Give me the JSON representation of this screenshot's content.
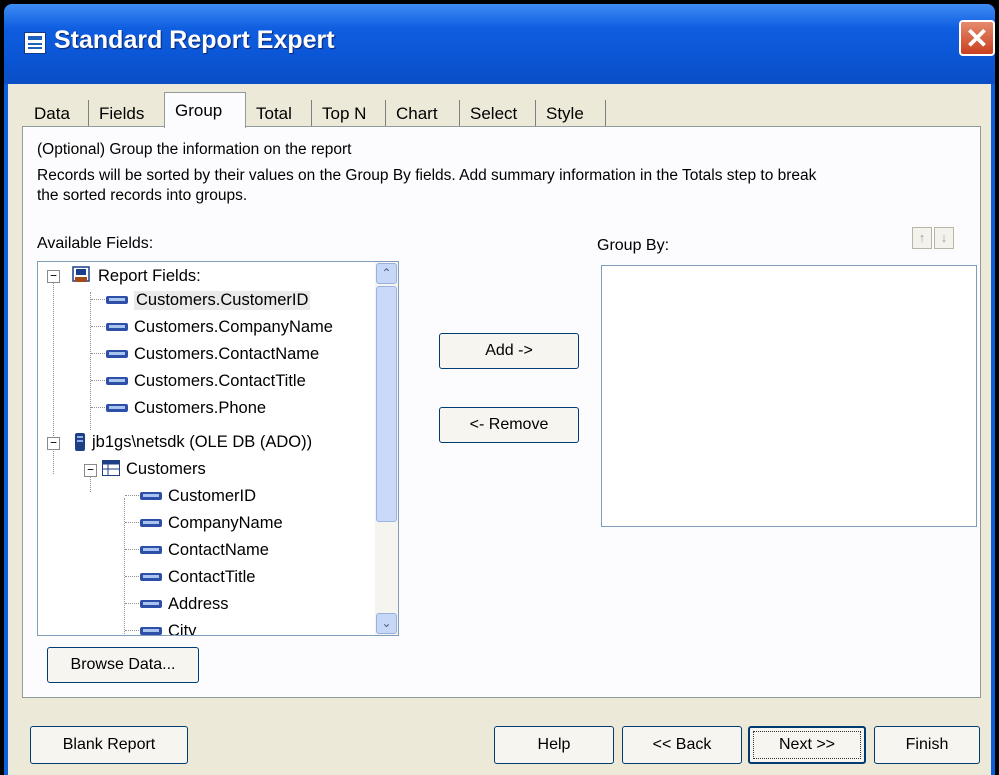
{
  "window": {
    "title": "Standard Report Expert",
    "close_glyph": "✕"
  },
  "tabs": [
    "Data",
    "Fields",
    "Group",
    "Total",
    "Top N",
    "Chart",
    "Select",
    "Style"
  ],
  "active_tab": "Group",
  "description": {
    "line1": "(Optional)  Group the information on the report",
    "line2": "Records will be sorted by their values on the Group By fields.  Add summary information in the Totals step to break",
    "line3": "the sorted records into groups."
  },
  "available_fields": {
    "label": "Available Fields:",
    "report_fields_label": "Report Fields:",
    "report_fields": [
      "Customers.CustomerID",
      "Customers.CompanyName",
      "Customers.ContactName",
      "Customers.ContactTitle",
      "Customers.Phone"
    ],
    "connection_label": "jb1gs\\netsdk (OLE DB (ADO))",
    "table_label": "Customers",
    "table_fields": [
      "CustomerID",
      "CompanyName",
      "ContactName",
      "ContactTitle",
      "Address",
      "City"
    ]
  },
  "group_by": {
    "label": "Group By:"
  },
  "buttons": {
    "add": "Add ->",
    "remove": "<- Remove",
    "browse": "Browse Data...",
    "blank_report": "Blank Report",
    "help": "Help",
    "back": "<< Back",
    "next": "Next >>",
    "finish": "Finish",
    "move_up": "↑",
    "move_down": "↓"
  },
  "icons": {
    "scroll_up": "⌃",
    "scroll_down": "⌄",
    "expanded": "−"
  },
  "colors": {
    "title_bar": "#0a55d4",
    "dialog_bg": "#ece9d8",
    "selected_item": "#eaeaea"
  }
}
